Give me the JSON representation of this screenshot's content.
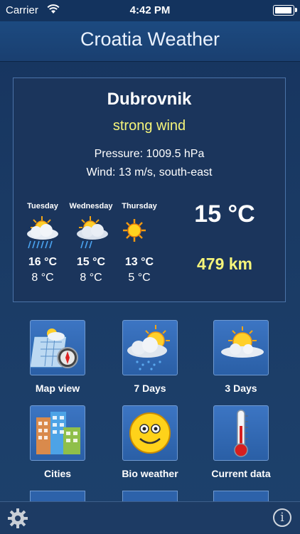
{
  "status_bar": {
    "carrier": "Carrier",
    "time": "4:42 PM"
  },
  "header": {
    "title": "Croatia Weather"
  },
  "current": {
    "city": "Dubrovnik",
    "condition": "strong wind",
    "pressure": "Pressure: 1009.5 hPa",
    "wind": "Wind: 13 m/s, south-east",
    "temperature": "15 °C",
    "distance": "479 km"
  },
  "forecast": [
    {
      "day": "Tuesday",
      "icon": "sun-cloud-rain-icon",
      "high": "16 °C",
      "low": "8 °C"
    },
    {
      "day": "Wednesday",
      "icon": "sun-cloud-drizzle-icon",
      "high": "15 °C",
      "low": "8 °C"
    },
    {
      "day": "Thursday",
      "icon": "sun-icon",
      "high": "13 °C",
      "low": "5 °C"
    }
  ],
  "menu": [
    {
      "label": "Map view",
      "icon": "map-compass-icon"
    },
    {
      "label": "7 Days",
      "icon": "cloud-sun-rain-icon"
    },
    {
      "label": "3 Days",
      "icon": "sun-cloud-icon"
    },
    {
      "label": "Cities",
      "icon": "buildings-icon"
    },
    {
      "label": "Bio weather",
      "icon": "smiley-icon"
    },
    {
      "label": "Current data",
      "icon": "thermometer-icon"
    }
  ],
  "colors": {
    "accent_yellow": "#f6f57a",
    "tile_blue": "#3c75c3",
    "panel": "#1b355c"
  }
}
